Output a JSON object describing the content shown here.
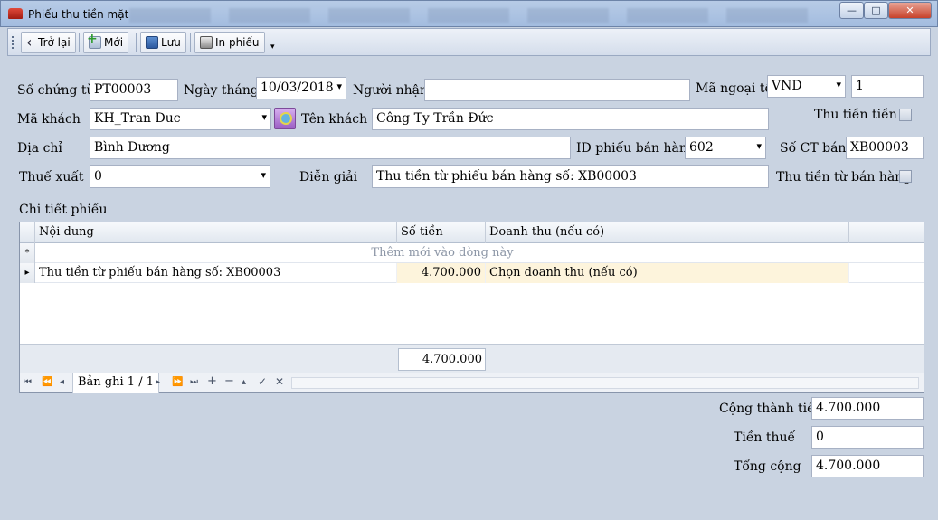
{
  "window": {
    "title": "Phiếu thu tiền mặt",
    "min_glyph": "—",
    "max_glyph": "□",
    "close_glyph": "✕"
  },
  "toolbar": {
    "back": "Trở lại",
    "new": "Mới",
    "save": "Lưu",
    "print": "In phiếu",
    "overflow": "▾"
  },
  "form": {
    "so_chung_tu": {
      "label": "Số chứng từ",
      "value": "PT00003"
    },
    "ngay_thang": {
      "label": "Ngày tháng",
      "value": "10/03/2018"
    },
    "nguoi_nhan": {
      "label": "Người nhận",
      "value": ""
    },
    "ma_ngoai_te": {
      "label": "Mã ngoại tệ",
      "value": "VND",
      "rate": "1"
    },
    "ma_khach": {
      "label": "Mã khách",
      "value": "KH_Tran Duc"
    },
    "ten_khach": {
      "label": "Tên khách",
      "value": "Công Ty Trần Đức"
    },
    "thu_tien_tien": {
      "label": "Thu tiền tiền"
    },
    "dia_chi": {
      "label": "Địa chỉ",
      "value": "Bình Dương"
    },
    "id_phieu_ban_hang": {
      "label": "ID phiếu bán hàng",
      "value": "602"
    },
    "so_ct_ban": {
      "label": "Số CT bán",
      "value": "XB00003"
    },
    "thue_xuat": {
      "label": "Thuế xuất",
      "value": "0"
    },
    "dien_giai": {
      "label": "Diễn giải",
      "value": "Thu tiền từ phiếu bán hàng số: XB00003"
    },
    "thu_tien_tu_ban_hang": {
      "label": "Thu tiền từ bán hàng"
    }
  },
  "detail": {
    "title": "Chi tiết phiếu",
    "columns": [
      "Nội dung",
      "Số tiền",
      "Doanh thu (nếu có)"
    ],
    "new_row_marker": "*",
    "new_row_text": "Thêm mới vào dòng này",
    "rows": [
      {
        "marker": "▸",
        "noi_dung": "Thu tiền từ phiếu bán hàng số: XB00003",
        "so_tien": "4.700.000",
        "doanh_thu": "Chọn doanh thu (nếu có)"
      }
    ],
    "sum": "4.700.000",
    "navigator": {
      "text": "Bản ghi 1 / 1"
    }
  },
  "totals": {
    "cong_thanh_tien": {
      "label": "Cộng thành tiền",
      "value": "4.700.000"
    },
    "tien_thue": {
      "label": "Tiền thuế",
      "value": "0"
    },
    "tong_cong": {
      "label": "Tổng cộng",
      "value": "4.700.000"
    }
  },
  "colors": {
    "background": "#c9d3e1",
    "row_highlight": "#fdf4dc"
  }
}
